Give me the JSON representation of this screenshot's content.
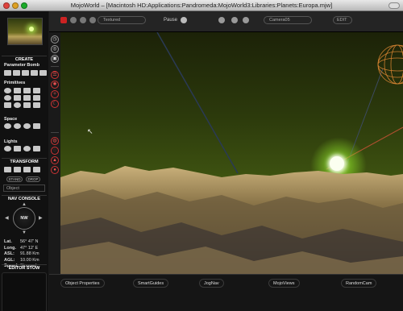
{
  "window": {
    "title": "MojoWorld – [Macintosh HD:Applications:Pandromeda:MojoWorld3:Libraries:Planets:Europa.mjw]"
  },
  "toolbar": {
    "render_mode": "Textured",
    "pause_label": "Pause",
    "camera_field": "Camera05",
    "edit_label": "EDIT"
  },
  "left_panel": {
    "create_title": "CREATE",
    "param_bomb_label": "Parameter Bomb",
    "primitives_label": "Primitives",
    "space_label": "Space",
    "lights_label": "Lights",
    "transform_title": "TRANSFORM",
    "stand_label": "STAND",
    "drop_label": "DROP",
    "object_selector": "Object",
    "nav_console_title": "NAV CONSOLE",
    "nav_heading": "NW",
    "readouts": [
      {
        "label": "Lat.",
        "value": "56° 47' N"
      },
      {
        "label": "Long.",
        "value": "47° 12' E"
      },
      {
        "label": "ASL:",
        "value": "91.88 Km"
      },
      {
        "label": "AGL:",
        "value": "10.00 Km"
      },
      {
        "label": "Speed:",
        "value": "Stopped"
      }
    ],
    "editor_title": "EDITOR STOW"
  },
  "bottombar": {
    "object_properties": "Object Properties",
    "smart_guides": "SmartGuides",
    "jog_nav": "JogNav",
    "mojo_views": "MojoViews",
    "random_cam": "RandomCam"
  },
  "colors": {
    "accent_red": "#cc2222",
    "sky_green": "#3c5010",
    "sun_glow": "#d2ff78",
    "terrain_tan": "#b79a58"
  }
}
